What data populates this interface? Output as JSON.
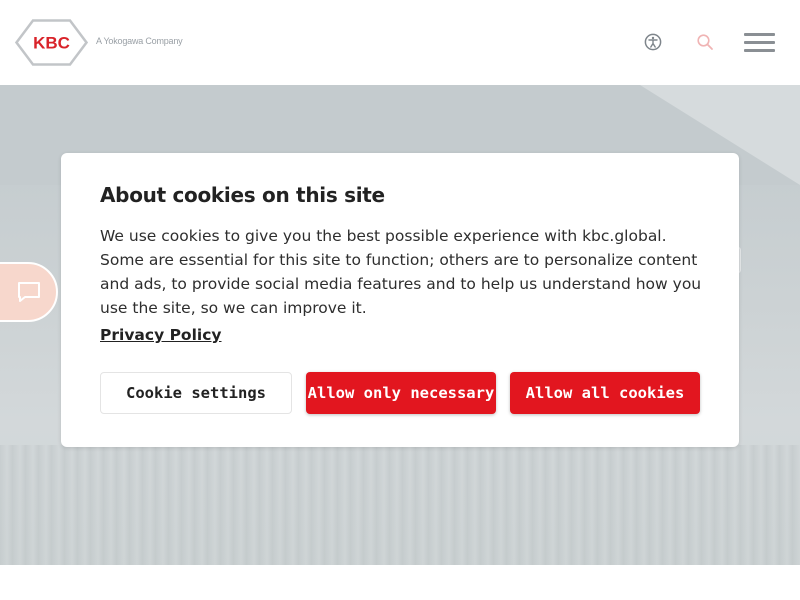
{
  "header": {
    "logo_text": "KBC",
    "tagline": "A Yokogawa Company",
    "icons": {
      "accessibility": "accessibility-icon",
      "search": "search-icon",
      "menu": "hamburger-menu-icon"
    }
  },
  "chat": {
    "icon": "chat-bubble-icon"
  },
  "cookie_modal": {
    "title": "About cookies on this site",
    "body": "We use cookies to give you the best possible experience with kbc.global. Some are essential for this site to function; others are to personalize content and ads, to provide social media features and to help us understand how you use the site, so we can improve it.",
    "privacy_link": "Privacy Policy",
    "buttons": {
      "settings": "Cookie settings",
      "necessary": "Allow only necessary",
      "all": "Allow all cookies"
    }
  },
  "colors": {
    "brand_red": "#e2161f",
    "logo_grey": "#b8bcc0",
    "search_icon": "#f0b4b4",
    "chat_tab": "#f7d7cc"
  }
}
